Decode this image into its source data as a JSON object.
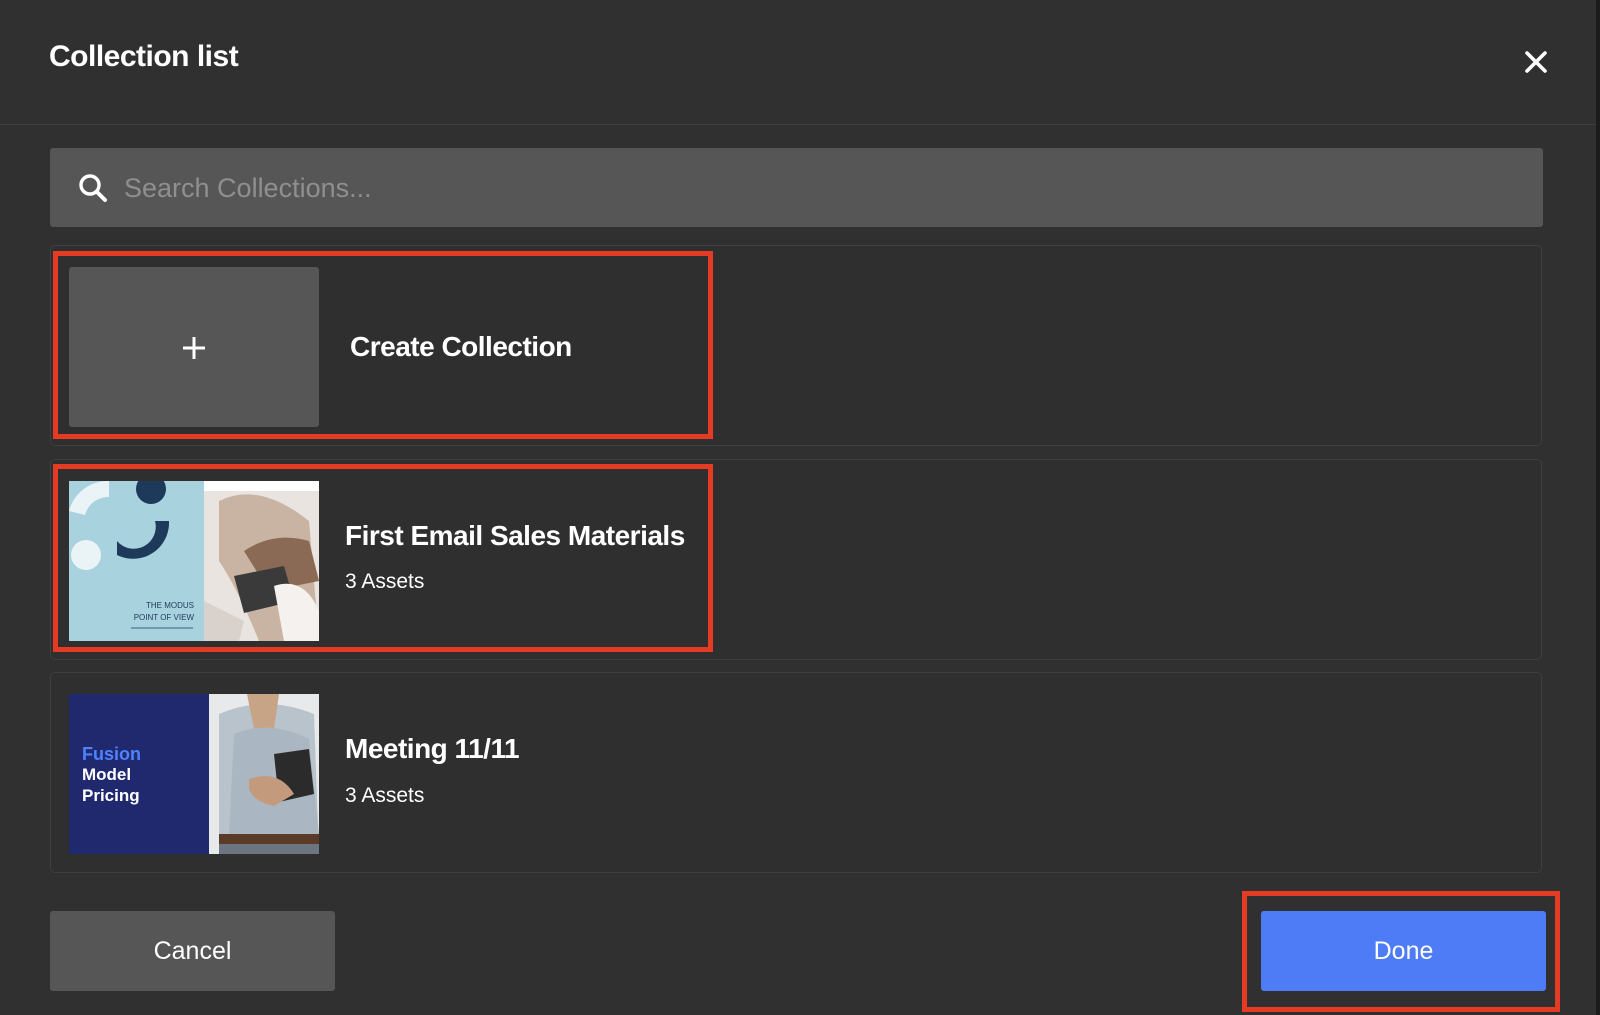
{
  "header": {
    "title": "Collection list",
    "close_icon": "close-icon"
  },
  "search": {
    "placeholder": "Search Collections...",
    "value": "",
    "icon": "search-icon"
  },
  "collections": [
    {
      "name": "Create Collection",
      "icon": "plus-icon"
    },
    {
      "name": "First Email Sales Materials",
      "count": "3 Assets",
      "thumbnail": {
        "lines": [
          "THE MODUS",
          "POINT OF VIEW"
        ],
        "colors": [
          "#a9d2df",
          "#1e3a5a"
        ]
      }
    },
    {
      "name": "Meeting 11/11",
      "count": "3 Assets",
      "thumbnail": {
        "lines": [
          "Fusion",
          "Model",
          "Pricing"
        ],
        "colors": [
          "#20296e",
          "#4f82ff"
        ]
      }
    }
  ],
  "footer": {
    "cancel_label": "Cancel",
    "done_label": "Done"
  },
  "colors": {
    "background": "#303030",
    "input": "#565656",
    "primary": "#4d7cf6",
    "highlight": "#e53a24"
  }
}
